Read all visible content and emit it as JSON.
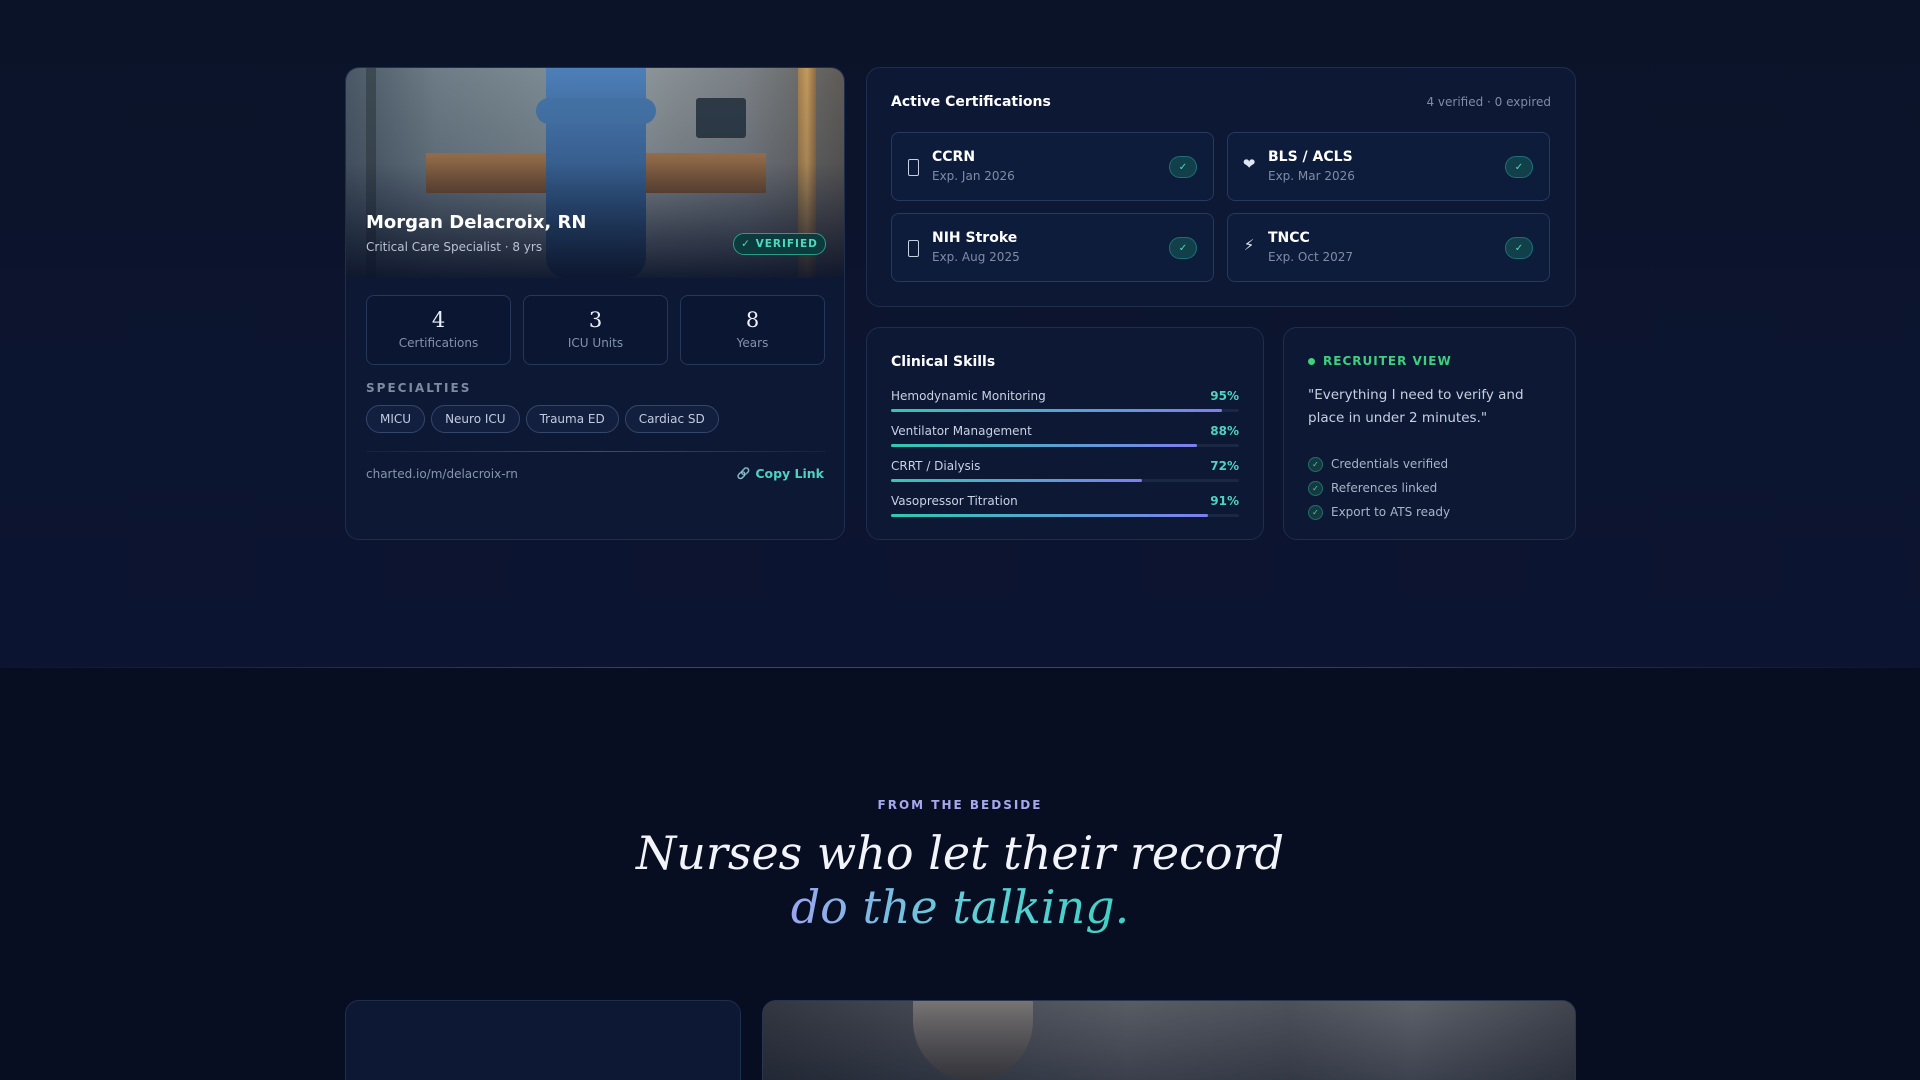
{
  "profile": {
    "name": "Morgan Delacroix, RN",
    "subtitle": "Critical Care Specialist · 8 yrs",
    "verified_badge": "✓ VERIFIED",
    "stats": [
      {
        "value": "4",
        "label": "Certifications"
      },
      {
        "value": "3",
        "label": "ICU Units"
      },
      {
        "value": "8",
        "label": "Years"
      }
    ],
    "specialties_label": "SPECIALTIES",
    "specialties": [
      "MICU",
      "Neuro ICU",
      "Trauma ED",
      "Cardiac SD"
    ],
    "url": "charted.io/m/delacroix-rn",
    "copy_label": "Copy Link"
  },
  "certifications": {
    "title": "Active Certifications",
    "summary": "4 verified · 0 expired",
    "items": [
      {
        "name": "CCRN",
        "expiry": "Exp. Jan 2026",
        "icon": "badge-icon"
      },
      {
        "name": "BLS / ACLS",
        "expiry": "Exp. Mar 2026",
        "icon": "heart-icon"
      },
      {
        "name": "NIH Stroke",
        "expiry": "Exp. Aug 2025",
        "icon": "badge-icon"
      },
      {
        "name": "TNCC",
        "expiry": "Exp. Oct 2027",
        "icon": "lightning-icon"
      }
    ],
    "check_glyph": "✓"
  },
  "skills": {
    "title": "Clinical Skills",
    "items": [
      {
        "name": "Hemodynamic Monitoring",
        "percent_label": "95%",
        "level": 0.95
      },
      {
        "name": "Ventilator Management",
        "percent_label": "88%",
        "level": 0.88
      },
      {
        "name": "CRRT / Dialysis",
        "percent_label": "72%",
        "level": 0.72
      },
      {
        "name": "Vasopressor Titration",
        "percent_label": "91%",
        "level": 0.91
      }
    ]
  },
  "recruiter": {
    "label": "RECRUITER VIEW",
    "quote": "\"Everything I need to verify and place in under 2 minutes.\"",
    "checks": [
      "Credentials verified",
      "References linked",
      "Export to ATS ready"
    ]
  },
  "bedside": {
    "eyebrow": "FROM THE BEDSIDE",
    "headline_line1": "Nurses who let their record",
    "headline_line2": "do the talking."
  },
  "colors": {
    "background": "#0a1024",
    "accent_teal": "#4fd3bf",
    "accent_green": "#3fcf7f",
    "accent_violet": "#a6a8ee"
  }
}
